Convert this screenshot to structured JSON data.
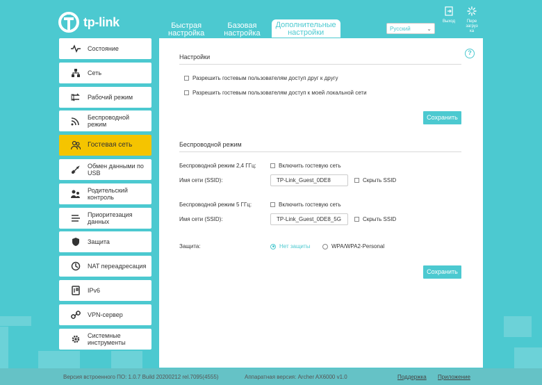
{
  "brand": {
    "logo_text": "tp-link",
    "accent": "#4cc9d0",
    "active_nav": "#f5c400"
  },
  "tabs": [
    {
      "line1": "Быстрая",
      "line2": "настройка"
    },
    {
      "line1": "Базовая",
      "line2": "настройка"
    },
    {
      "line1": "Дополнительные",
      "line2": "настройки"
    }
  ],
  "language": {
    "selected": "Русский"
  },
  "topbar": {
    "logout": "Выход",
    "reboot_line1": "Пере",
    "reboot_line2": "загруз",
    "reboot_line3": "ка"
  },
  "sidebar": {
    "items": [
      {
        "icon": "pulse-icon",
        "line1": "Состояние",
        "line2": ""
      },
      {
        "icon": "network-icon",
        "line1": "Сеть",
        "line2": ""
      },
      {
        "icon": "mode-icon",
        "line1": "Рабочий режим",
        "line2": ""
      },
      {
        "icon": "wireless-icon",
        "line1": "Беспроводной",
        "line2": "режим"
      },
      {
        "icon": "guest-icon",
        "line1": "Гостевая сеть",
        "line2": ""
      },
      {
        "icon": "usb-icon",
        "line1": "Обмен данными по",
        "line2": "USB"
      },
      {
        "icon": "parental-icon",
        "line1": "Родительский",
        "line2": "контроль"
      },
      {
        "icon": "qos-icon",
        "line1": "Приоритезация",
        "line2": "данных"
      },
      {
        "icon": "shield-icon",
        "line1": "Защита",
        "line2": ""
      },
      {
        "icon": "nat-icon",
        "line1": "NAT переадресация",
        "line2": ""
      },
      {
        "icon": "ipv6-icon",
        "line1": "IPv6",
        "line2": ""
      },
      {
        "icon": "vpn-icon",
        "line1": "VPN-сервер",
        "line2": ""
      },
      {
        "icon": "tools-icon",
        "line1": "Системные",
        "line2": "инструменты"
      }
    ]
  },
  "settings": {
    "title": "Настройки",
    "allow_guests_each_other": "Разрешить гостевым пользователям доступ друг к другу",
    "allow_guests_lan": "Разрешить гостевым пользователям доступ к моей локальной сети",
    "save": "Сохранить"
  },
  "wireless": {
    "title": "Беспроводной режим",
    "band24_label": "Беспроводной режим 2,4 ГГц:",
    "enable_guest": "Включить гостевую сеть",
    "ssid_label": "Имя сети (SSID):",
    "ssid24": "TP-Link_Guest_0DE8",
    "hide_ssid": "Скрыть SSID",
    "band5_label": "Беспроводной режим 5 ГГц:",
    "ssid5": "TP-Link_Guest_0DE8_5G",
    "security_label": "Защита:",
    "security_none": "Нет защиты",
    "security_wpa": "WPA/WPA2-Personal",
    "save": "Сохранить"
  },
  "footer": {
    "firmware": "Версия встроенного ПО: 1.0.7 Build 20200212 rel.7095(4555)",
    "hardware": "Аппаратная версия: Archer AX6000 v1.0",
    "support": "Поддержка",
    "app": "Приложение"
  }
}
